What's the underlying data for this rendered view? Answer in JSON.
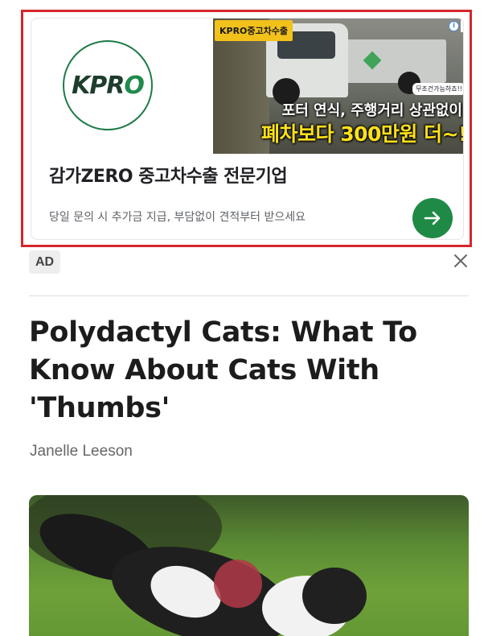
{
  "ad": {
    "logo_text_a": "KPR",
    "logo_text_b": "O",
    "image": {
      "tag": "KPRO중고차수출",
      "sticker": "무조건가능하죠!!",
      "headline1": "포터 연식, 주행거리 상관없이",
      "headline2": "폐차보다 300만원 더~!"
    },
    "choices_info": "i",
    "choices_menu": "⋮",
    "title": "감가ZERO 중고차수출 전문기업",
    "description": "당일 문의 시 추가금 지급, 부담없이 견적부터 받으세요",
    "label": "AD",
    "colors": {
      "frame": "#d6252b",
      "cta": "#1e8a46",
      "headline2": "#ffe11a"
    }
  },
  "article": {
    "title": "Polydactyl Cats: What To Know About Cats With 'Thumbs'",
    "author": "Janelle Leeson"
  }
}
